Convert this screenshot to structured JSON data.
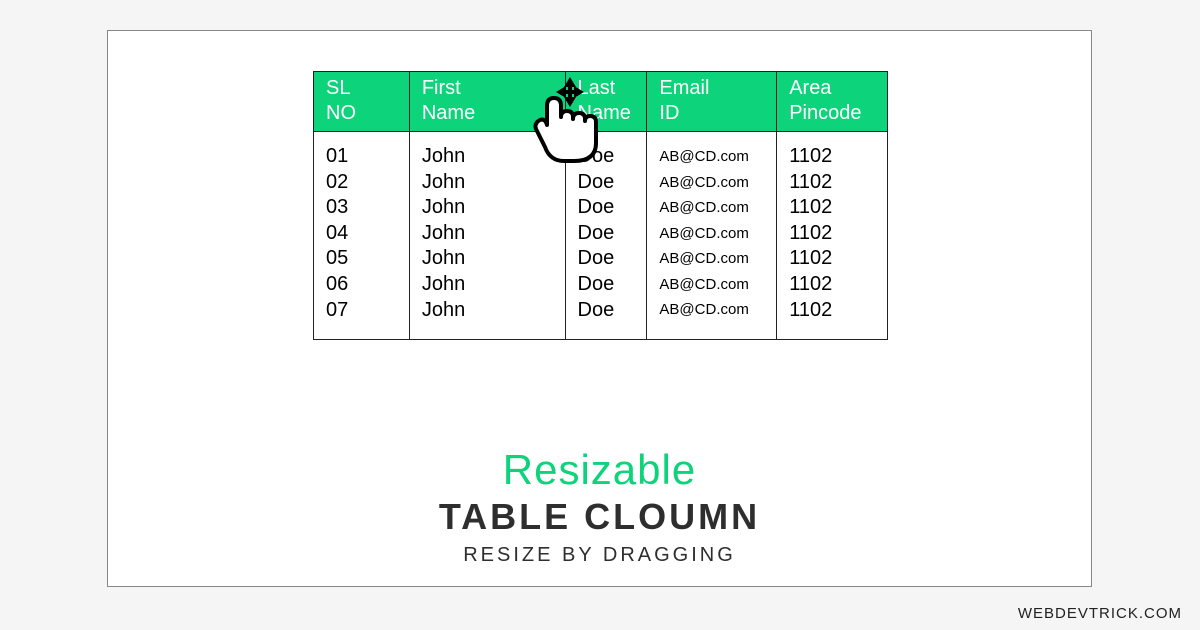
{
  "table": {
    "headers": [
      {
        "l1": "SL",
        "l2": "NO"
      },
      {
        "l1": "First",
        "l2": "Name"
      },
      {
        "l1": "Last",
        "l2": "Name"
      },
      {
        "l1": "Email",
        "l2": "ID"
      },
      {
        "l1": "Area",
        "l2": "Pincode"
      }
    ],
    "rows": [
      {
        "sl": "01",
        "first": "John",
        "last": "Doe",
        "email": "AB@CD.com",
        "pin": "1102"
      },
      {
        "sl": "02",
        "first": "John",
        "last": "Doe",
        "email": "AB@CD.com",
        "pin": "1102"
      },
      {
        "sl": "03",
        "first": "John",
        "last": "Doe",
        "email": "AB@CD.com",
        "pin": "1102"
      },
      {
        "sl": "04",
        "first": "John",
        "last": "Doe",
        "email": "AB@CD.com",
        "pin": "1102"
      },
      {
        "sl": "05",
        "first": "John",
        "last": "Doe",
        "email": "AB@CD.com",
        "pin": "1102"
      },
      {
        "sl": "06",
        "first": "John",
        "last": "Doe",
        "email": "AB@CD.com",
        "pin": "1102"
      },
      {
        "sl": "07",
        "first": "John",
        "last": "Doe",
        "email": "AB@CD.com",
        "pin": "1102"
      }
    ]
  },
  "titles": {
    "line1": "Resizable",
    "line2": "TABLE CLOUMN",
    "line3": "RESIZE BY DRAGGING"
  },
  "attribution": "WEBDEVTRICK.COM",
  "colors": {
    "accent": "#0dd37a"
  }
}
